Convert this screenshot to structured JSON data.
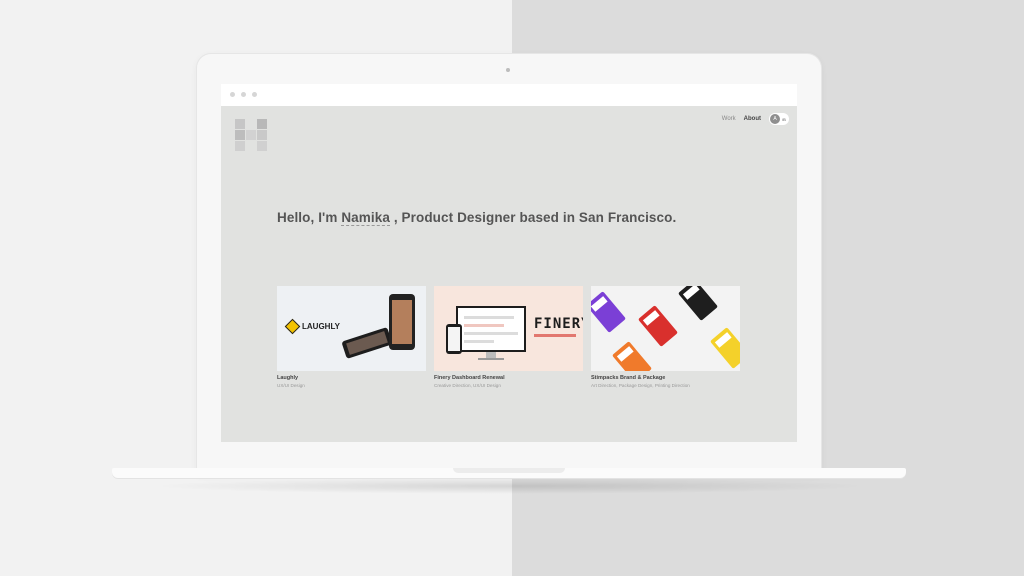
{
  "nav": {
    "work": "Work",
    "about": "About",
    "avatar_letter": "A",
    "avatar_code": "/B"
  },
  "hero": {
    "prefix": "Hello, I'm ",
    "name": "Namika",
    "suffix": " , Product Designer based in San Francisco."
  },
  "projects": [
    {
      "title": "Laughly",
      "tags": "UX/UI Design",
      "brand": "LAUGHLY"
    },
    {
      "title": "Finery Dashboard Renewal",
      "tags": "Creative Direction, UX/UI Design",
      "brand": "FINERY"
    },
    {
      "title": "Stimpacks Brand & Package",
      "tags": "Art Direction, Package Design, Printing Direction"
    }
  ],
  "colors": {
    "page_bg": "#e1e2e0",
    "laughly_yellow": "#f2c200",
    "finery_bg": "#f8e6dd",
    "finery_accent": "#e2776e",
    "stimpacks_purple": "#7b3fd6",
    "stimpacks_red": "#d9302d",
    "stimpacks_orange": "#f07a2b",
    "stimpacks_yellow": "#f4d12a"
  }
}
